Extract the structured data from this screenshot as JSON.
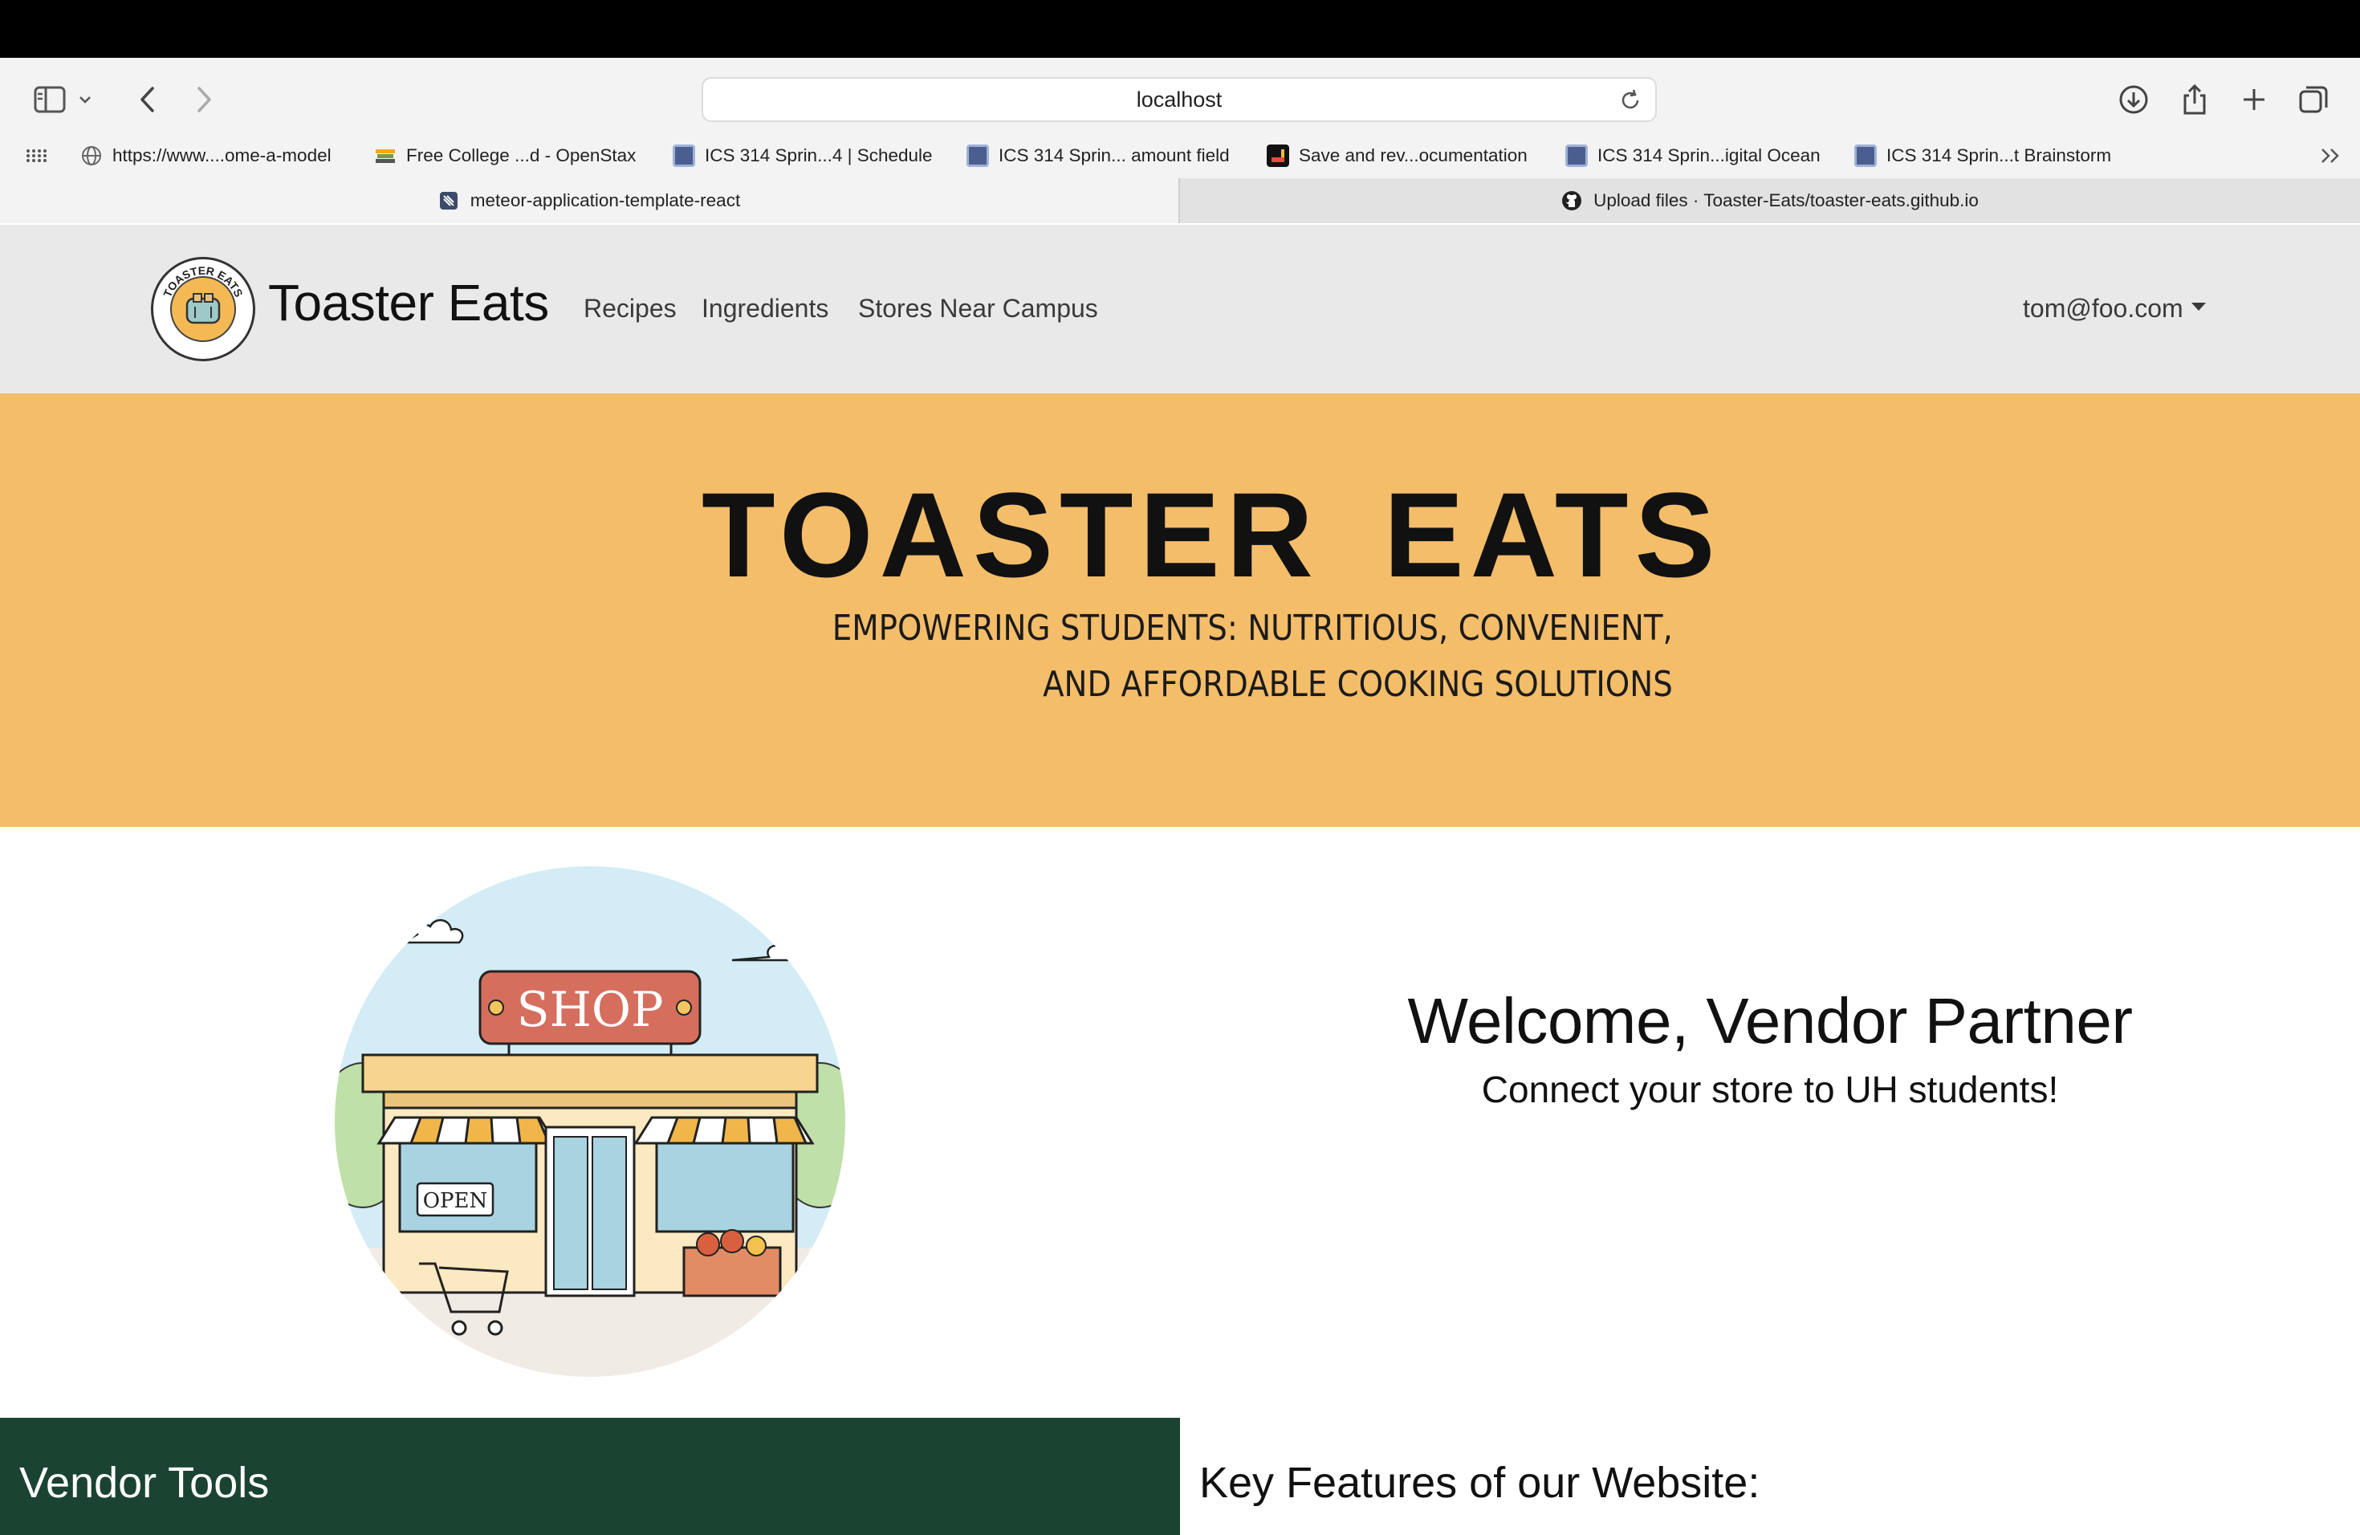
{
  "browser": {
    "url": "localhost",
    "bookmarks": [
      {
        "label": "https://www....ome-a-model",
        "icon": "globe-icon"
      },
      {
        "label": "Free College ...d - OpenStax",
        "icon": "openstax-icon"
      },
      {
        "label": "ICS 314 Sprin...4 | Schedule",
        "icon": "page-icon"
      },
      {
        "label": "ICS 314 Sprin... amount field",
        "icon": "page-icon"
      },
      {
        "label": "Save and rev...ocumentation",
        "icon": "app-icon"
      },
      {
        "label": "ICS 314 Sprin...igital Ocean",
        "icon": "page-icon"
      },
      {
        "label": "ICS 314 Sprin...t Brainstorm",
        "icon": "page-icon"
      }
    ],
    "tabs": [
      {
        "label": "meteor-application-template-react",
        "active": true
      },
      {
        "label": "Upload files · Toaster-Eats/toaster-eats.github.io",
        "active": false
      }
    ]
  },
  "navbar": {
    "brand": "Toaster Eats",
    "logo_text": "TOASTER EATS",
    "links": [
      "Recipes",
      "Ingredients",
      "Stores Near Campus"
    ],
    "user": "tom@foo.com"
  },
  "hero": {
    "title": "TOASTER  EATS",
    "subtitle_line1": "EMPOWERING STUDENTS: NUTRITIOUS, CONVENIENT,",
    "subtitle_line2": "AND AFFORDABLE COOKING SOLUTIONS"
  },
  "welcome": {
    "heading": "Welcome, Vendor Partner",
    "subheading": "Connect your store to UH students!",
    "shop_sign": "SHOP",
    "open_sign": "OPEN"
  },
  "sections": {
    "vendor_tools": "Vendor Tools",
    "key_features": "Key Features of our Website:"
  },
  "colors": {
    "hero_bg": "#f4bd6a",
    "navbar_bg": "#e9e9e9",
    "vendor_tools_bg": "#1b4332"
  }
}
